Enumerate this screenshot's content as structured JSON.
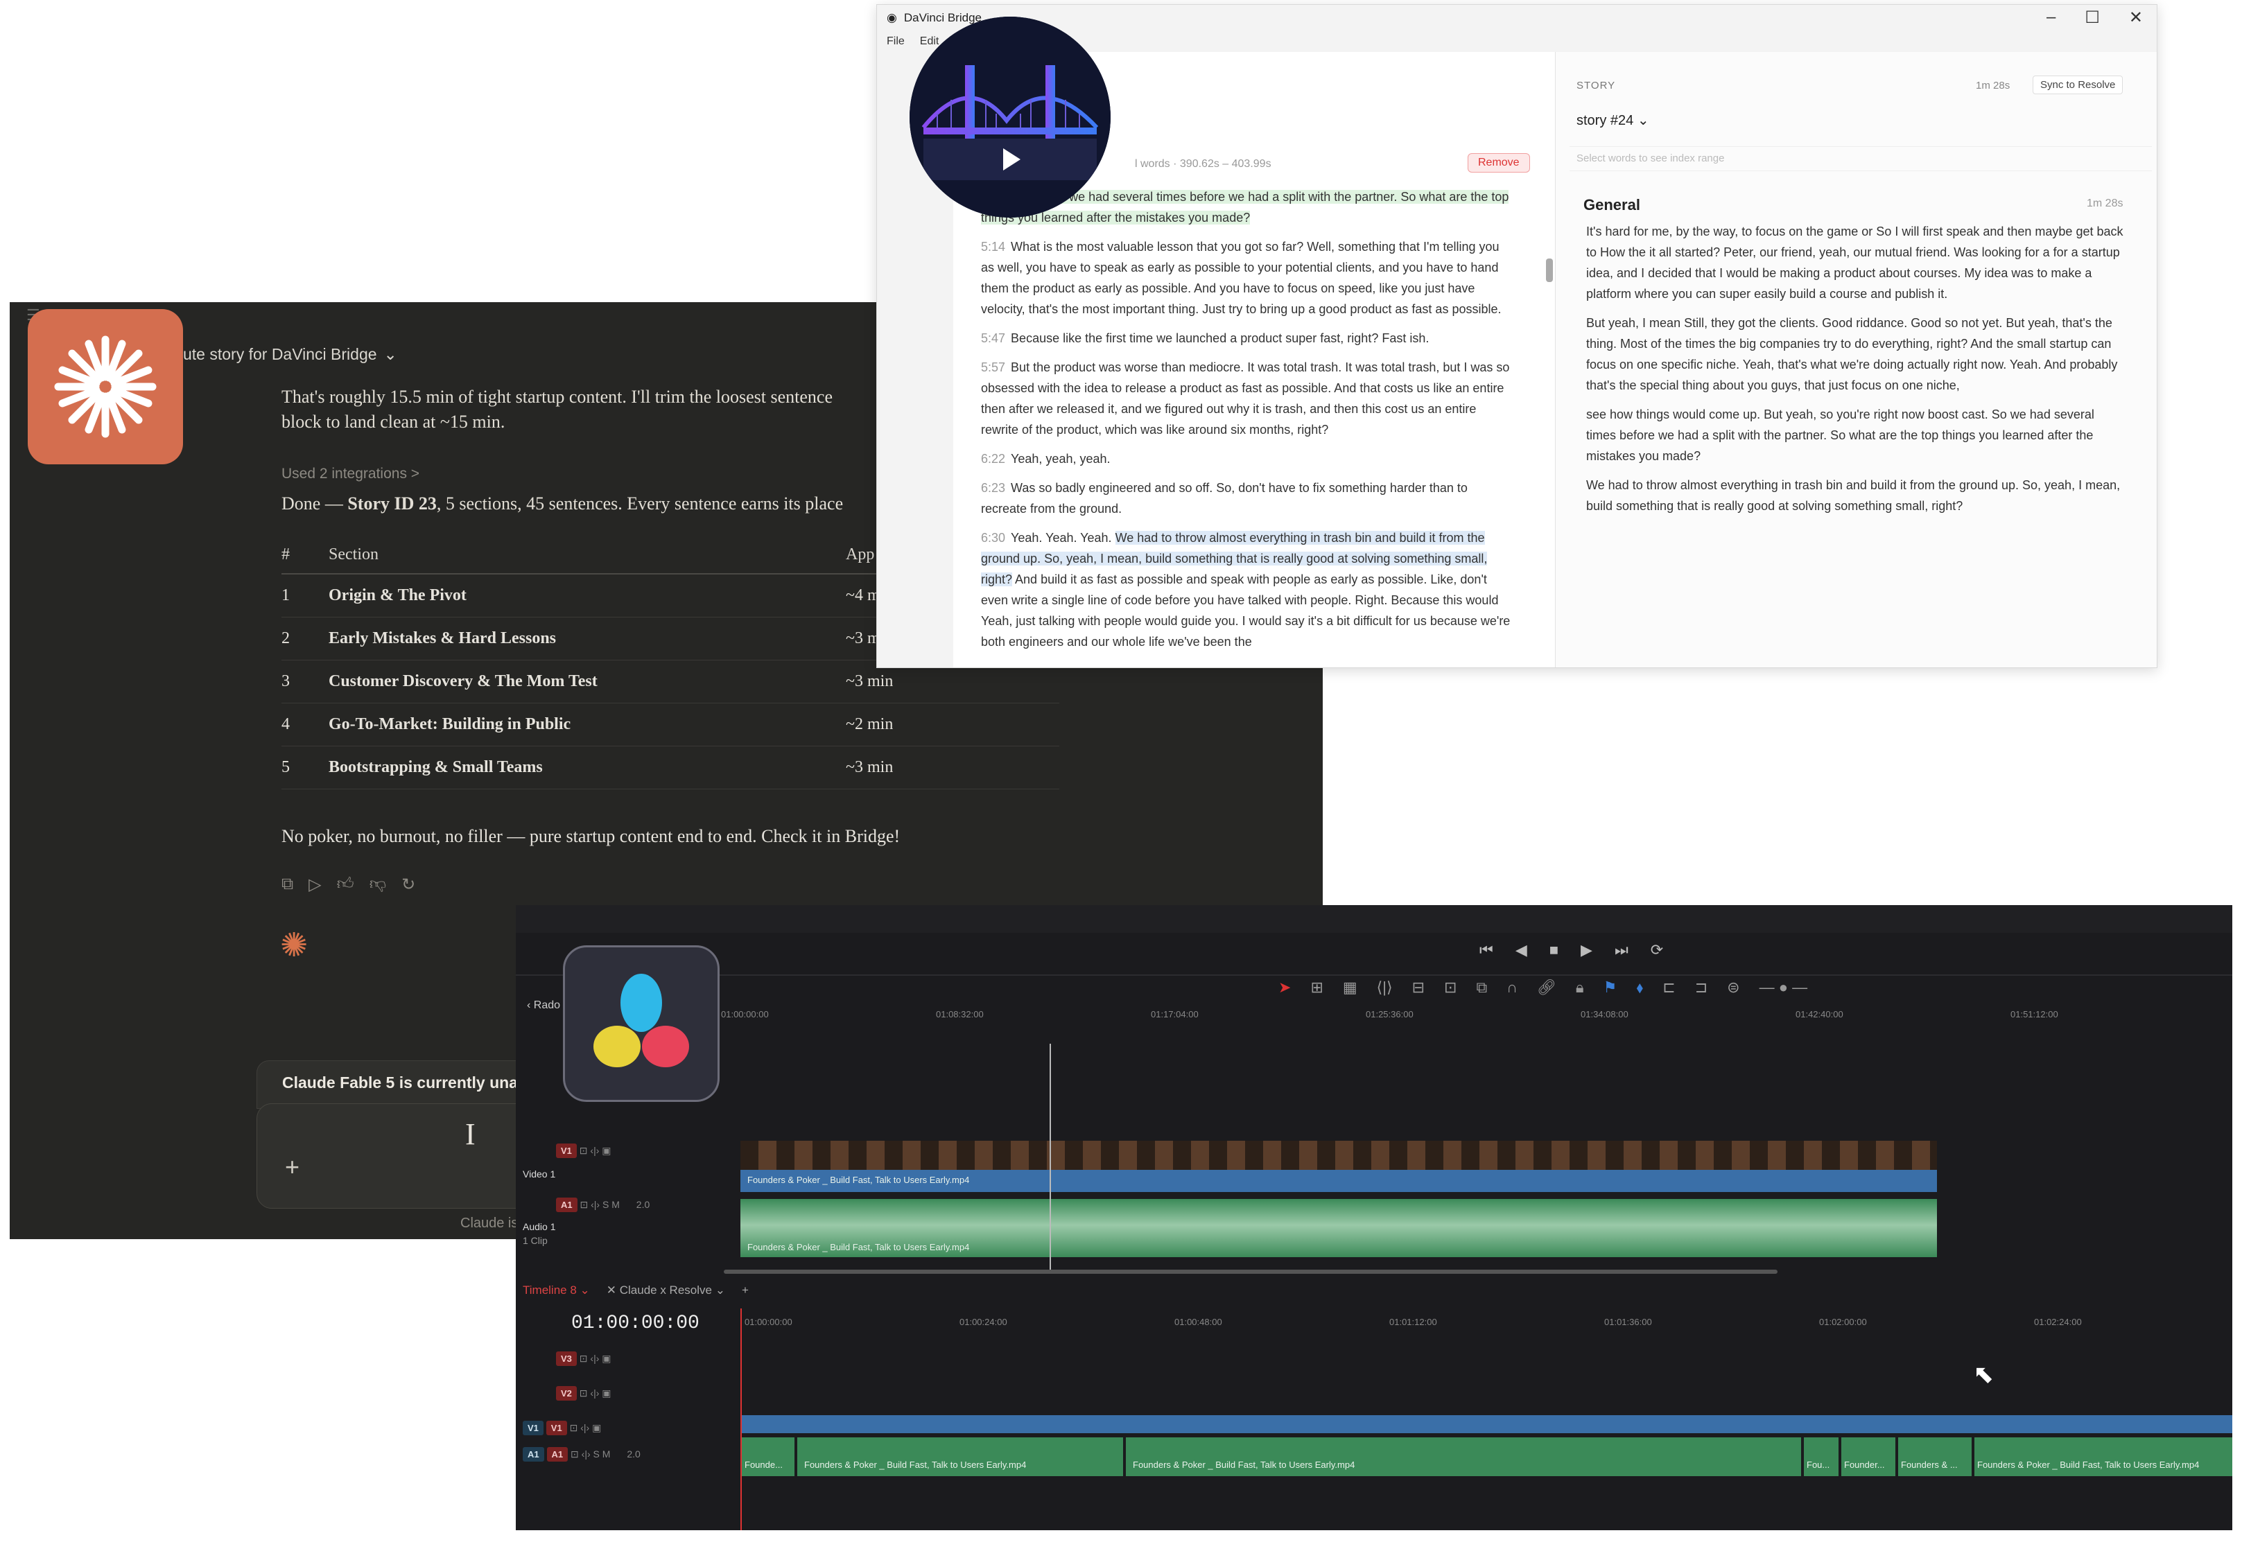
{
  "claude": {
    "header_title": "ute story for DaVinci Bridge",
    "msg_line1": "That's roughly 15.5 min of tight startup content. I'll trim the loosest sentence",
    "msg_line2": "block to land clean at ~15 min.",
    "integrations": "Used 2 integrations  >",
    "done_prefix": "Done — ",
    "done_bold": "Story ID 23",
    "done_suffix": ", 5 sections, 45 sentences. Every sentence earns its place",
    "table": {
      "headers": [
        "#",
        "Section",
        "App"
      ],
      "rows": [
        {
          "num": "1",
          "section": "Origin & The Pivot",
          "approx": "~4 m"
        },
        {
          "num": "2",
          "section": "Early Mistakes & Hard Lessons",
          "approx": "~3 m"
        },
        {
          "num": "3",
          "section": "Customer Discovery & The Mom Test",
          "approx": "~3 min"
        },
        {
          "num": "4",
          "section": "Go-To-Market: Building in Public",
          "approx": "~2 min"
        },
        {
          "num": "5",
          "section": "Bootstrapping & Small Teams",
          "approx": "~3 min"
        }
      ]
    },
    "closing": "No poker, no burnout, no filler — pure startup content end to end. Check it in Bridge!",
    "unavailable": "Claude Fable 5 is currently unavail",
    "footer": "Claude is",
    "accent": "#d46e4f"
  },
  "bridge": {
    "window_title": "DaVinci Bridge",
    "menu": [
      "File",
      "Edit"
    ],
    "range_words": "l words  · 390.62s – 403.99s",
    "remove_label": "Remove",
    "transcript": [
      {
        "ts": "",
        "pre": "",
        "hl": "boost cast. So we had several times before we had a split with the partner. So what are the top things you learned after the mistakes you made?",
        "post": "",
        "hlclass": "hl-green"
      },
      {
        "ts": "5:14",
        "pre": "What is the most valuable lesson that you got so far? Well, something that I'm telling you as well, you have to speak as early as possible to your potential clients, and you have to hand them the product as early as possible. And you have to focus on speed, like you just have velocity, that's the most important thing. Just try to bring up a good product as fast as possible.",
        "hl": "",
        "post": "",
        "hlclass": ""
      },
      {
        "ts": "5:47",
        "pre": "Because like the first time we launched a product super fast, right? Fast ish.",
        "hl": "",
        "post": "",
        "hlclass": ""
      },
      {
        "ts": "5:57",
        "pre": "But the product was worse than mediocre. It was total trash. It was total trash, but I was so obsessed with the idea to release a product as fast as possible. And that costs us like an entire then after we released it, and we figured out why it is trash, and then this cost us an entire rewrite of the product, which was like around six months, right?",
        "hl": "",
        "post": "",
        "hlclass": ""
      },
      {
        "ts": "6:22",
        "pre": "Yeah, yeah, yeah.",
        "hl": "",
        "post": "",
        "hlclass": ""
      },
      {
        "ts": "6:23",
        "pre": "Was so badly engineered and so off. So, don't have to fix something harder than to recreate from the ground.",
        "hl": "",
        "post": "",
        "hlclass": ""
      },
      {
        "ts": "6:30",
        "pre": "Yeah. Yeah. Yeah. ",
        "hl": "We had to throw almost everything in trash bin and build it from the ground up. So, yeah, I mean, build something that is really good at solving something small, right?",
        "post": " And build it as fast as possible and speak with people as early as possible. Like, don't even write a single line of code before you have talked with people. Right. Because this would Yeah, just talking with people would guide you. I would say it's a bit difficult for us because we're both engineers and our whole life we've been the",
        "hlclass": "hl-blue"
      }
    ],
    "story_label": "STORY",
    "story_duration": "1m 28s",
    "sync_label": "Sync to Resolve",
    "story_select": "story #24",
    "index_hint": "Select words to see index range",
    "section_title": "General",
    "section_duration": "1m 28s",
    "section_paragraphs": [
      "It's hard for me, by the way, to focus on the game or So I will first speak and then maybe get back to How the it all started? Peter, our friend, yeah, our mutual friend. Was looking for a for a startup idea, and I decided that I would be making a product about courses. My idea was to make a platform where you can super easily build a course and publish it.",
      "But yeah, I mean Still, they got the clients. Good riddance. Good so not yet. But yeah, that's the thing. Most of the times the big companies try to do everything, right? And the small startup can focus on one specific niche. Yeah, that's what we're doing actually right now. Yeah. And probably that's the special thing about you guys, that just focus on one niche,",
      "see how things would come up. But yeah, so you're right now boost cast. So we had several times before we had a split with the partner. So what are the top things you learned after the mistakes you made?",
      "We had to throw almost everything in trash bin and build it from the ground up. So, yeah, I mean, build something that is really good at solving something small, right?"
    ]
  },
  "resolve": {
    "upper_track_name": "Rado",
    "upper_ruler": [
      "01:00:00:00",
      "01:08:32:00",
      "01:17:04:00",
      "01:25:36:00",
      "01:34:08:00",
      "01:42:40:00",
      "01:51:12:00"
    ],
    "video1_label": "Video 1",
    "audio1_label": "Audio 1",
    "audio1_sub": "1 Clip",
    "v1": "V1",
    "a1": "A1",
    "level": "2.0",
    "clip_name": "Founders & Poker _ Build Fast, Talk to Users Early.mp4",
    "tab1": "Timeline 8",
    "tab2": "Claude x Resolve",
    "timecode": "01:00:00:00",
    "lower_ruler": [
      "01:00:00:00",
      "01:00:24:00",
      "01:00:48:00",
      "01:01:12:00",
      "01:01:36:00",
      "01:02:00:00",
      "01:02:24:00"
    ],
    "v3": "V3",
    "v2": "V2",
    "s": "S",
    "m": "M",
    "lower_clips": [
      "Founde...",
      "Founders & Poker _ Build Fast, Talk to Users Early.mp4",
      "Founders & Poker _ Build Fast, Talk to Users Early.mp4",
      "Fou...",
      "Founder...",
      "Founders & ...",
      "Founders & Poker _ Build Fast, Talk to Users Early.mp4"
    ]
  }
}
